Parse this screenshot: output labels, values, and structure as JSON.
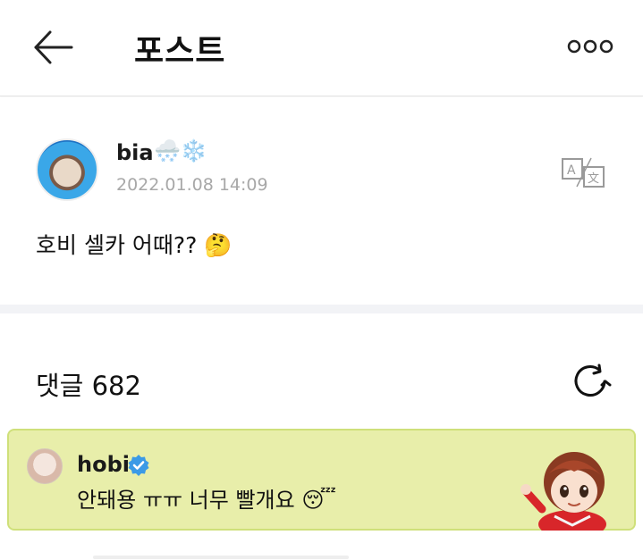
{
  "header": {
    "title": "포스트",
    "back_icon": "arrow-left-icon",
    "more_icon": "more-dots-icon"
  },
  "post": {
    "author": "bia",
    "author_emoji": "🌨️❄️",
    "timestamp": "2022.01.08 14:09",
    "text": "호비 셀카 어때?? 🤔",
    "translate_icon": "translate-icon"
  },
  "comments": {
    "label": "댓글 682",
    "refresh_icon": "refresh-icon"
  },
  "highlighted_comment": {
    "author": "hobi",
    "verified_icon": "verified-badge-icon",
    "text": "안돼용 ㅠㅠ 너무 빨개요 😴",
    "background": "#e8eeaa",
    "border": "#cfe07a"
  },
  "colors": {
    "accent_blue": "#3b9ae6",
    "timestamp_gray": "#a8a8a8",
    "divider": "#f2f3f6"
  }
}
